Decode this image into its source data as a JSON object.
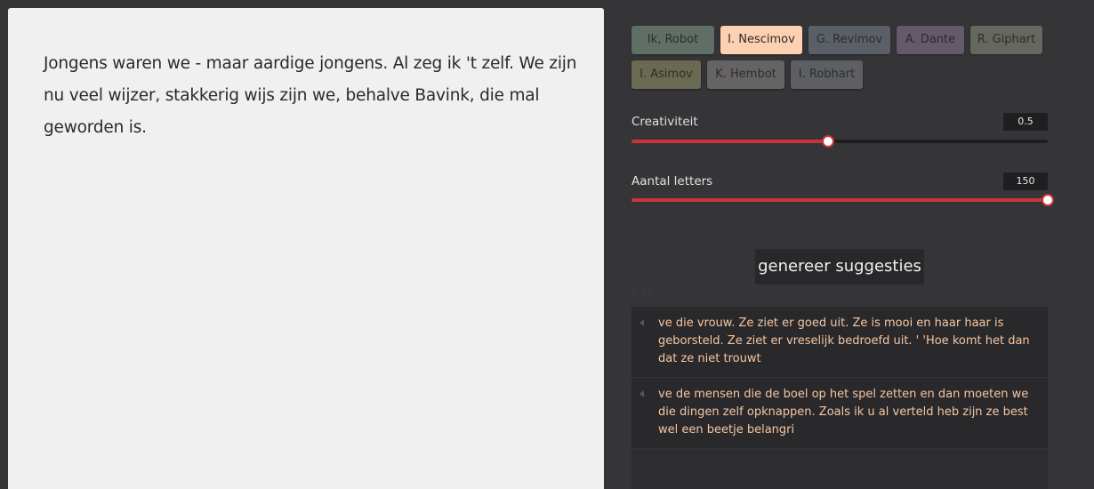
{
  "editor": {
    "text": "Jongens waren we - maar aardige jongens. Al zeg ik 't zelf. We zijn nu veel wijzer, stakkerig wijs zijn we, behalve Bavink, die mal geworden is."
  },
  "authors": [
    {
      "label": "Ik, Robot",
      "bg": "#5f6f66",
      "fg": "#2b2f2c",
      "selected": false
    },
    {
      "label": "I. Nescimov",
      "bg": "#fdd0b1",
      "fg": "#2a2a2a",
      "selected": true
    },
    {
      "label": "G. Revimov",
      "bg": "#5b6068",
      "fg": "#2b2c2f",
      "selected": false
    },
    {
      "label": "A. Dante",
      "bg": "#65596a",
      "fg": "#2c2930",
      "selected": false
    },
    {
      "label": "R. Giphart",
      "bg": "#65685f",
      "fg": "#2c2d2a",
      "selected": false
    },
    {
      "label": "I. Asimov",
      "bg": "#6a6a53",
      "fg": "#2e2e25",
      "selected": false
    },
    {
      "label": "K. Hembot",
      "bg": "#656363",
      "fg": "#2d2c2c",
      "selected": false
    },
    {
      "label": "I. Robhart",
      "bg": "#5d5f64",
      "fg": "#2b2c2e",
      "selected": false
    }
  ],
  "sliders": {
    "creativity": {
      "label": "Creativiteit",
      "value": "0.5",
      "fraction": 0.473
    },
    "letters": {
      "label": "Aantal letters",
      "value": "150",
      "fraction": 1.0
    }
  },
  "generate": {
    "label": "genereer suggesties"
  },
  "faint_label": "0.25",
  "suggestions": [
    {
      "text": "ve die vrouw. Ze ziet er goed uit. Ze is mooi en haar haar is geborsteld. Ze ziet er vreselijk bedroefd uit. ' 'Hoe komt het dan dat ze niet trouwt"
    },
    {
      "text": "ve de mensen die de boel op het spel zetten en dan moeten we die dingen zelf opknappen. Zoals ik u al verteld heb zijn ze best wel een beetje belangri"
    }
  ],
  "colors": {
    "accent": "#c8353a",
    "suggestion_text": "#f6c6a2"
  }
}
